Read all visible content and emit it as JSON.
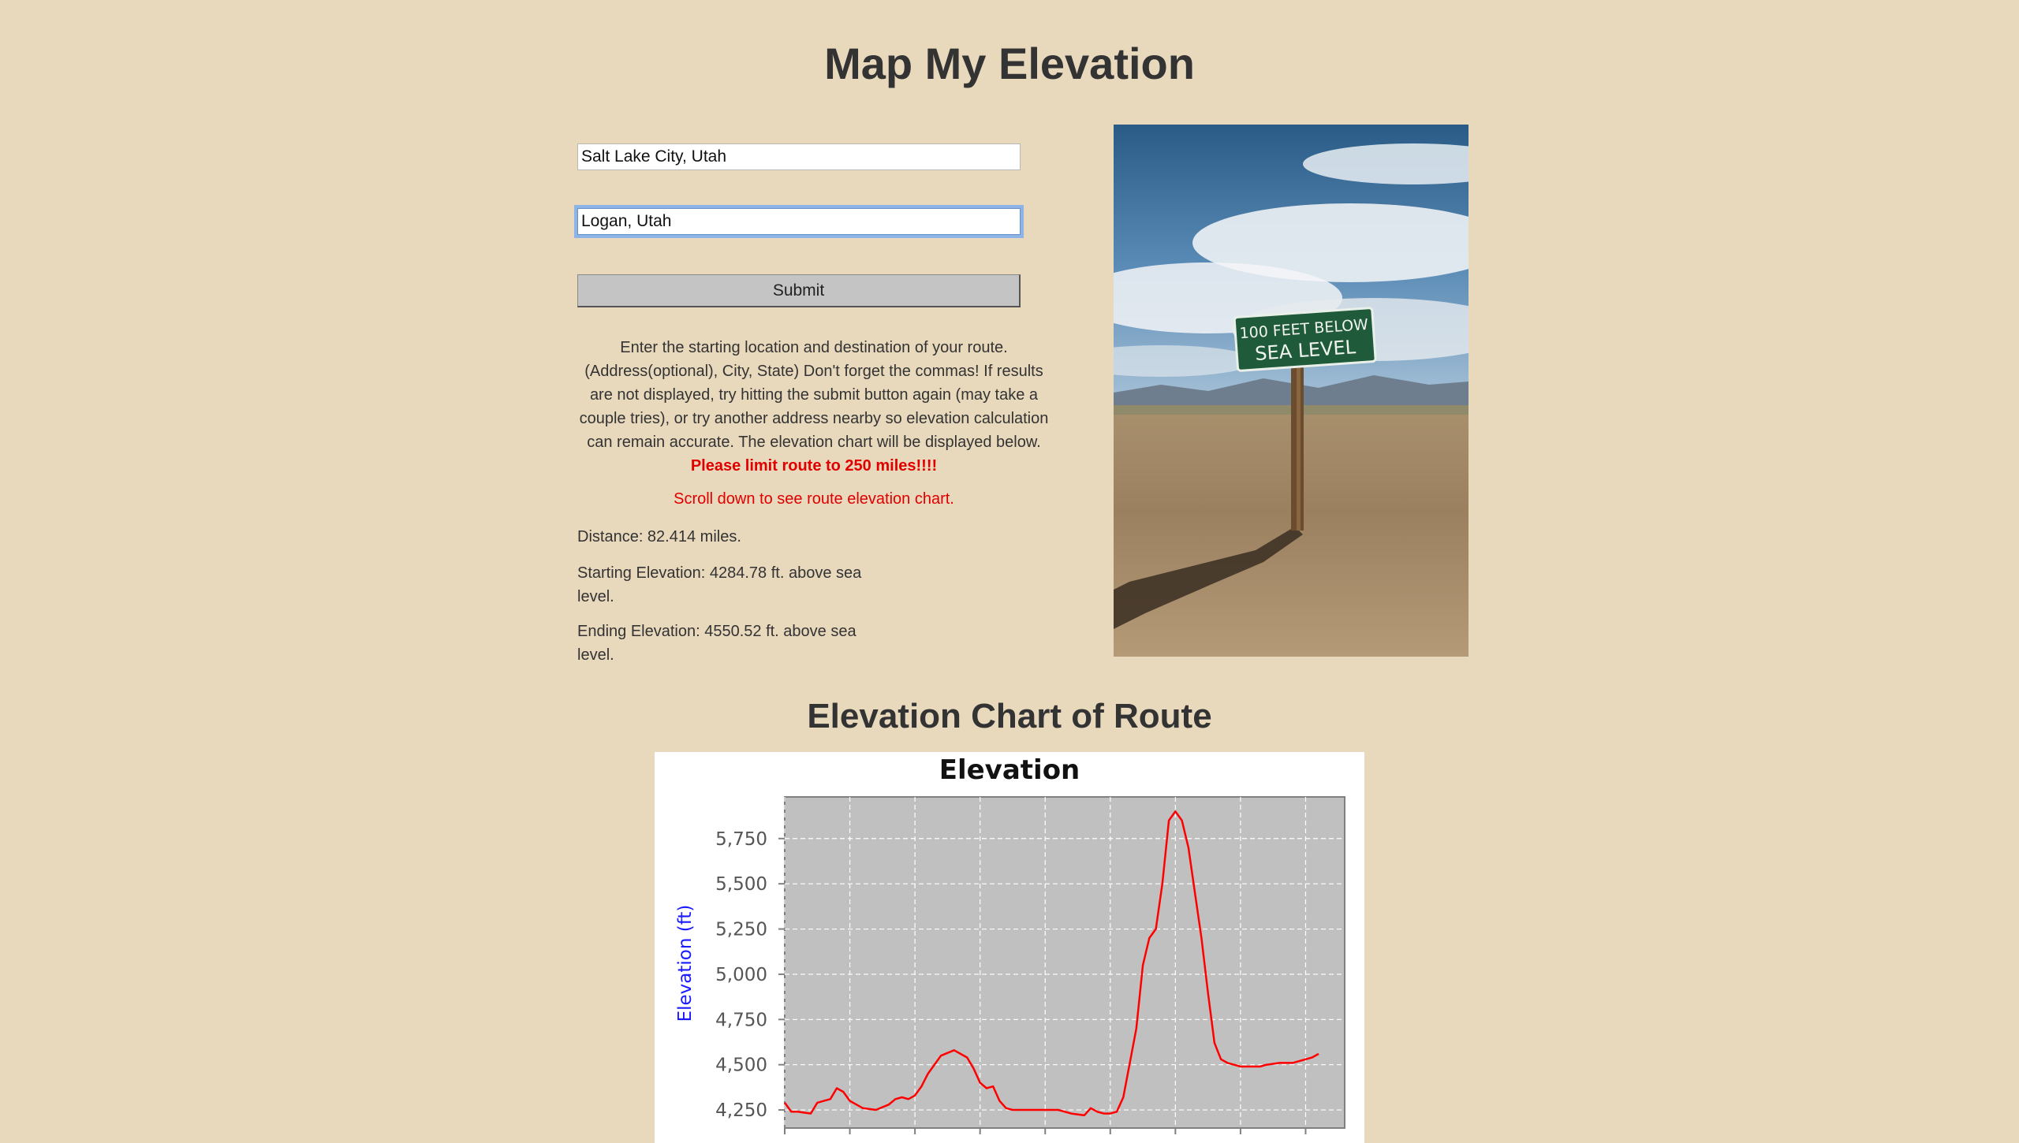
{
  "header": {
    "title": "Map My Elevation"
  },
  "form": {
    "origin_value": "Salt Lake City, Utah",
    "destination_value": "Logan, Utah",
    "submit_label": "Submit"
  },
  "instructions": {
    "text": "Enter the starting location and destination of your route. (Address(optional), City, State) Don't forget the commas! If results are not displayed, try hitting the submit button again (may take a couple tries), or try another address nearby so elevation calculation can remain accurate. The elevation chart will be displayed below.",
    "warning": "Please limit route to 250 miles!!!!",
    "scroll_note": "Scroll down to see route elevation chart."
  },
  "results": {
    "distance": "Distance: 82.414 miles.",
    "starting_elevation": "Starting Elevation: 4284.78 ft. above sea level.",
    "ending_elevation": "Ending Elevation: 4550.52 ft. above sea level."
  },
  "photo": {
    "sign_line1": "100 FEET BELOW",
    "sign_line2": "SEA LEVEL"
  },
  "chart_section": {
    "heading": "Elevation Chart of Route"
  },
  "chart_data": {
    "type": "line",
    "title": "Elevation",
    "xlabel": "",
    "ylabel": "Elevation (ft)",
    "xlim": [
      0,
      86
    ],
    "ylim": [
      4150,
      5980
    ],
    "yticks": [
      4250,
      4500,
      4750,
      5000,
      5250,
      5500,
      5750
    ],
    "ytick_labels": [
      "4,250",
      "4,500",
      "4,750",
      "5,000",
      "5,250",
      "5,500",
      "5,750"
    ],
    "xticks": [
      0,
      10,
      20,
      30,
      40,
      50,
      60,
      70,
      80
    ],
    "grid": true,
    "series": [
      {
        "color": "#ff0000",
        "x": [
          0,
          1,
          2,
          4,
          5,
          6,
          7,
          8,
          9,
          10,
          11,
          12,
          14,
          16,
          17,
          18,
          19,
          20,
          21,
          22,
          24,
          26,
          28,
          29,
          30,
          31,
          32,
          33,
          34,
          35,
          36,
          37,
          38,
          40,
          42,
          44,
          46,
          47,
          48,
          49,
          50,
          51,
          52,
          54,
          55,
          56,
          57,
          58,
          59,
          60,
          61,
          62,
          63,
          64,
          65,
          66,
          67,
          68,
          69,
          70,
          71,
          72,
          73,
          74,
          76,
          78,
          80,
          81,
          82
        ],
        "y": [
          4290,
          4240,
          4240,
          4230,
          4290,
          4300,
          4310,
          4370,
          4350,
          4300,
          4280,
          4260,
          4250,
          4280,
          4310,
          4320,
          4310,
          4330,
          4380,
          4450,
          4550,
          4580,
          4540,
          4480,
          4400,
          4370,
          4380,
          4300,
          4260,
          4250,
          4250,
          4250,
          4250,
          4250,
          4250,
          4230,
          4220,
          4260,
          4240,
          4230,
          4230,
          4240,
          4320,
          4700,
          5050,
          5200,
          5250,
          5500,
          5850,
          5900,
          5850,
          5700,
          5450,
          5200,
          4900,
          4620,
          4530,
          4510,
          4500,
          4490,
          4490,
          4490,
          4490,
          4500,
          4510,
          4510,
          4530,
          4540,
          4560
        ]
      }
    ]
  }
}
